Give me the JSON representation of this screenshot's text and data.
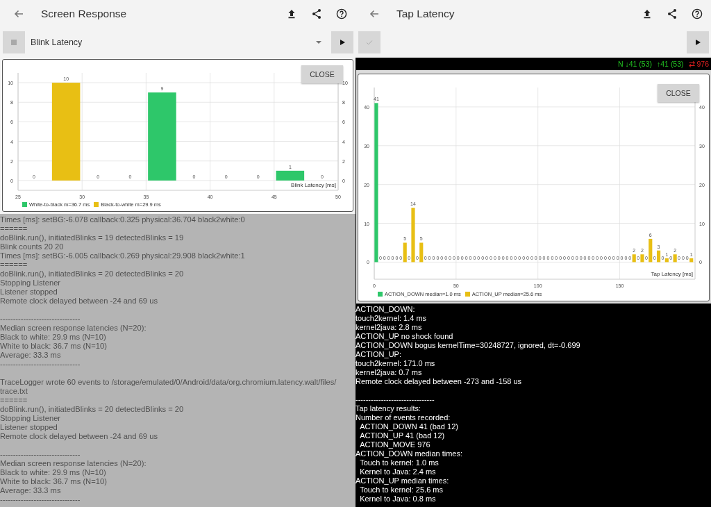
{
  "panels": [
    {
      "kind": "blink",
      "title": "Screen Response",
      "dropdown": {
        "value": "Blink Latency"
      },
      "close_button": "CLOSE",
      "chart_data": {
        "type": "bar",
        "grid": true,
        "xlabel": "Blink Latency [ms]",
        "x": [
          26.25,
          28.75,
          31.25,
          33.75,
          36.25,
          38.75,
          41.25,
          43.75,
          46.25,
          48.75
        ],
        "xlim": [
          25,
          50
        ],
        "ylim": [
          -1,
          11
        ],
        "xticks": [
          25,
          30,
          35,
          40,
          45,
          50
        ],
        "yticks": [
          0,
          2,
          4,
          6,
          8,
          10
        ],
        "y2ticks": [
          0,
          2,
          4,
          6,
          8,
          10
        ],
        "y2lim": [
          -1,
          11
        ],
        "series": [
          {
            "name": "White-to-black m=36.7 ms",
            "color": "#2ec76a",
            "values": [
              0,
              0,
              0,
              0,
              9,
              0,
              0,
              0,
              1,
              0
            ],
            "value_labels": [
              "0",
              null,
              "0",
              "0",
              "9",
              "0",
              "0",
              "0",
              "1",
              "0"
            ]
          },
          {
            "name": "Black-to-white m=29.9 ms",
            "color": "#e8bf14",
            "values": [
              0,
              10,
              0,
              0,
              0,
              0,
              0,
              0,
              0,
              0
            ],
            "value_labels": [
              null,
              "10",
              null,
              null,
              null,
              null,
              null,
              null,
              null,
              null
            ]
          }
        ]
      },
      "log": [
        [
          "Times [ms]: setBG:-6.078 callback:0.325 physical:36.704 black2white:0",
          "======",
          "doBlink.run(), initiatedBlinks = 19 detectedBlinks = 19",
          "Blink counts 20 20",
          "Times [ms]: setBG:-6.005 callback:0.269 physical:29.908 black2white:1",
          "======",
          "doBlink.run(), initiatedBlinks = 20 detectedBlinks = 20",
          "Stopping Listener",
          "Listener stopped",
          "Remote clock delayed between -24 and 69 us"
        ],
        [
          "-------------------------------",
          "Median screen response latencies (N=20):",
          "Black to white: 29.9 ms (N=10)",
          "White to black: 36.7 ms (N=10)",
          "Average: 33.3 ms",
          "-------------------------------"
        ],
        [
          "TraceLogger wrote 60 events to /storage/emulated/0/Android/data/org.chromium.latency.walt/files/ trace.txt",
          "======",
          "doBlink.run(), initiatedBlinks = 20 detectedBlinks = 20",
          "Stopping Listener",
          "Listener stopped",
          "Remote clock delayed between -24 and 69 us"
        ],
        [
          "-------------------------------",
          "Median screen response latencies (N=20):",
          "Black to white: 29.9 ms (N=10)",
          "White to black: 36.7 ms (N=10)",
          "Average: 33.3 ms",
          "-------------------------------"
        ]
      ]
    },
    {
      "kind": "tap",
      "title": "Tap Latency",
      "status": [
        {
          "text": "N ↓41 (53)",
          "color": "#22c322"
        },
        {
          "text": "↑41 (53)",
          "color": "#22c322"
        },
        {
          "text": "⇄ 976",
          "color": "#e02020"
        }
      ],
      "close_button": "CLOSE",
      "chart_data": {
        "type": "bar",
        "grid": true,
        "xlabel": "Tap Latency [ms]",
        "x": [
          1.25,
          3.75,
          6.25,
          8.75,
          11.25,
          13.75,
          16.25,
          18.75,
          21.25,
          23.75,
          26.25,
          28.75,
          31.25,
          33.75,
          36.25,
          38.75,
          41.25,
          43.75,
          46.25,
          48.75,
          51.25,
          53.75,
          56.25,
          58.75,
          61.25,
          63.75,
          66.25,
          68.75,
          71.25,
          73.75,
          76.25,
          78.75,
          81.25,
          83.75,
          86.25,
          88.75,
          91.25,
          93.75,
          96.25,
          98.75,
          101.25,
          103.75,
          106.25,
          108.75,
          111.25,
          113.75,
          116.25,
          118.75,
          121.25,
          123.75,
          126.25,
          128.75,
          131.25,
          133.75,
          136.25,
          138.75,
          141.25,
          143.75,
          146.25,
          148.75,
          151.25,
          153.75,
          156.25,
          158.75,
          161.25,
          163.75,
          166.25,
          168.75,
          171.25,
          173.75,
          176.25,
          178.75,
          181.25,
          183.75,
          186.25,
          188.75,
          191.25,
          193.75
        ],
        "xlim": [
          0,
          196
        ],
        "ylim": [
          -4.4,
          45
        ],
        "xticks": [
          0,
          50,
          100,
          150
        ],
        "yticks": [
          0,
          10,
          20,
          30,
          40
        ],
        "y2ticks": [
          0,
          10,
          20,
          30,
          40
        ],
        "y2lim": [
          -4.4,
          45
        ],
        "series": [
          {
            "name": "ACTION_DOWN median=1.0 ms",
            "color": "#2ec76a",
            "values": [
              41,
              0,
              0,
              0,
              0,
              0,
              0,
              0,
              0,
              0,
              0,
              0,
              0,
              0,
              0,
              0,
              0,
              0,
              0,
              0,
              0,
              0,
              0,
              0,
              0,
              0,
              0,
              0,
              0,
              0,
              0,
              0,
              0,
              0,
              0,
              0,
              0,
              0,
              0,
              0,
              0,
              0,
              0,
              0,
              0,
              0,
              0,
              0,
              0,
              0,
              0,
              0,
              0,
              0,
              0,
              0,
              0,
              0,
              0,
              0,
              0,
              0,
              0,
              0,
              0,
              0,
              0,
              0,
              0,
              0,
              0,
              0,
              0,
              0,
              0,
              0,
              0,
              0
            ],
            "value_labels": [
              "41",
              "0",
              "0",
              "0",
              "0",
              "0",
              "0",
              null,
              "0",
              null,
              "0",
              null,
              "0",
              "0",
              "0",
              "0",
              "0",
              "0",
              "0",
              "0",
              "0",
              "0",
              "0",
              "0",
              "0",
              "0",
              "0",
              "0",
              "0",
              "0",
              "0",
              "0",
              "0",
              "0",
              "0",
              "0",
              "0",
              "0",
              "0",
              "0",
              "0",
              "0",
              "0",
              "0",
              "0",
              "0",
              "0",
              "0",
              "0",
              "0",
              "0",
              "0",
              "0",
              "0",
              "0",
              "0",
              "0",
              "0",
              "0",
              "0",
              "0",
              "0",
              "0",
              null,
              "0",
              null,
              "0",
              null,
              "0",
              null,
              "0",
              null,
              "0",
              null,
              "0",
              "0",
              "0",
              null
            ]
          },
          {
            "name": "ACTION_UP median=25.6 ms",
            "color": "#e8bf14",
            "values": [
              0,
              0,
              0,
              0,
              0,
              0,
              0,
              5,
              0,
              14,
              0,
              5,
              0,
              0,
              0,
              0,
              0,
              0,
              0,
              0,
              0,
              0,
              0,
              0,
              0,
              0,
              0,
              0,
              0,
              0,
              0,
              0,
              0,
              0,
              0,
              0,
              0,
              0,
              0,
              0,
              0,
              0,
              0,
              0,
              0,
              0,
              0,
              0,
              0,
              0,
              0,
              0,
              0,
              0,
              0,
              0,
              0,
              0,
              0,
              0,
              0,
              0,
              0,
              2,
              0,
              2,
              0,
              6,
              0,
              3,
              0,
              1,
              0,
              2,
              0,
              0,
              0,
              1
            ],
            "value_labels": [
              null,
              null,
              null,
              null,
              null,
              null,
              null,
              "5",
              null,
              "14",
              null,
              "5",
              null,
              null,
              null,
              null,
              null,
              null,
              null,
              null,
              null,
              null,
              null,
              null,
              null,
              null,
              null,
              null,
              null,
              null,
              null,
              null,
              null,
              null,
              null,
              null,
              null,
              null,
              null,
              null,
              null,
              null,
              null,
              null,
              null,
              null,
              null,
              null,
              null,
              null,
              null,
              null,
              null,
              null,
              null,
              null,
              null,
              null,
              null,
              null,
              null,
              null,
              null,
              "2",
              null,
              "2",
              null,
              "6",
              null,
              "3",
              null,
              "1",
              null,
              "2",
              null,
              null,
              null,
              "1"
            ]
          }
        ]
      },
      "log": [
        [
          "ACTION_DOWN:",
          "touch2kernel: 1.4 ms",
          "kernel2java: 2.8 ms",
          "ACTION_UP no shock found",
          "ACTION_DOWN bogus kernelTime=30248727, ignored, dt=-0.699",
          "ACTION_UP:",
          "touch2kernel: 171.0 ms",
          "kernel2java: 0.7 ms",
          "Remote clock delayed between -273 and -158 us"
        ],
        [
          "-------------------------------",
          "Tap latency results:",
          "Number of events recorded:",
          "  ACTION_DOWN 41 (bad 12)",
          "  ACTION_UP 41 (bad 12)",
          "  ACTION_MOVE 976",
          "ACTION_DOWN median times:",
          "  Touch to kernel: 1.0 ms",
          "  Kernel to Java: 2.4 ms",
          "ACTION_UP median times:",
          "  Touch to kernel: 25.6 ms",
          "  Kernel to Java: 0.8 ms"
        ]
      ]
    }
  ]
}
